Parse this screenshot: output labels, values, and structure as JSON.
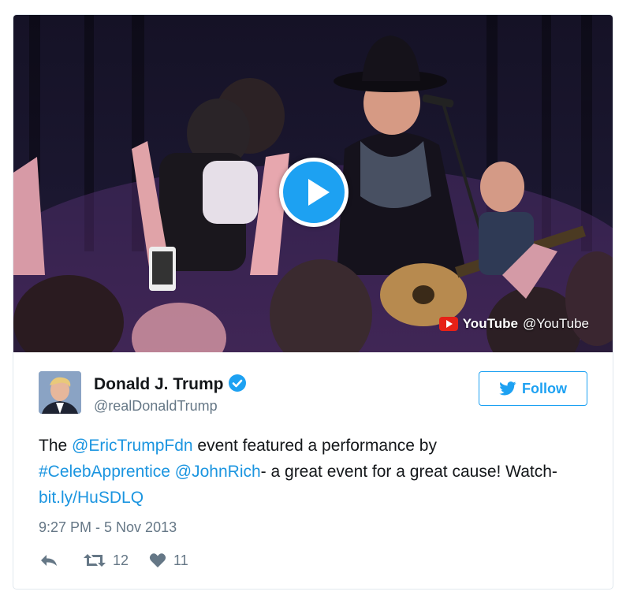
{
  "media": {
    "play_icon": "play-icon",
    "source_brand": "YouTube",
    "source_handle": "@YouTube",
    "accent_color": "#1da1f2"
  },
  "author": {
    "name": "Donald J. Trump",
    "handle": "@realDonaldTrump",
    "verified": true
  },
  "follow_button": {
    "label": "Follow",
    "icon": "twitter-bird-icon"
  },
  "tweet": {
    "parts": [
      {
        "text": "The "
      },
      {
        "text": "@EricTrumpFdn",
        "link": true
      },
      {
        "text": " event featured a performance by "
      },
      {
        "text": "#CelebApprentice",
        "link": true
      },
      {
        "text": " "
      },
      {
        "text": "@JohnRich",
        "link": true
      },
      {
        "text": "- a great event for a great cause! Watch- "
      },
      {
        "text": "bit.ly/HuSDLQ",
        "link": true
      }
    ]
  },
  "timestamp": "9:27 PM - 5 Nov 2013",
  "actions": {
    "reply_icon": "reply-icon",
    "retweet_count": "12",
    "like_count": "11"
  },
  "colors": {
    "link": "#1b95e0",
    "muted": "#657786",
    "text": "#14171a",
    "border": "#e1e8ed"
  }
}
